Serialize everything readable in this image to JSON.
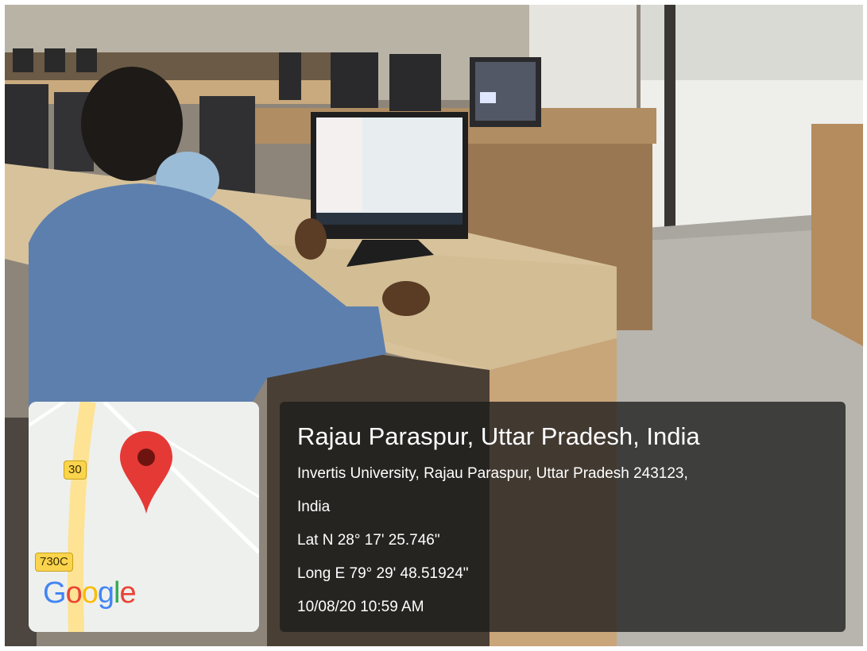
{
  "location": {
    "title": "Rajau Paraspur, Uttar Pradesh, India",
    "address_line1": "Invertis University, Rajau Paraspur, Uttar Pradesh 243123,",
    "address_line2": "India",
    "latitude": "Lat N 28° 17' 25.746\"",
    "longitude": "Long E 79° 29' 48.51924\"",
    "timestamp": "10/08/20 10:59 AM"
  },
  "map": {
    "road_shield_1": "30",
    "road_shield_2": "730C",
    "logo_letters": [
      "G",
      "o",
      "o",
      "g",
      "l",
      "e"
    ],
    "pin_color": "#E53935"
  }
}
